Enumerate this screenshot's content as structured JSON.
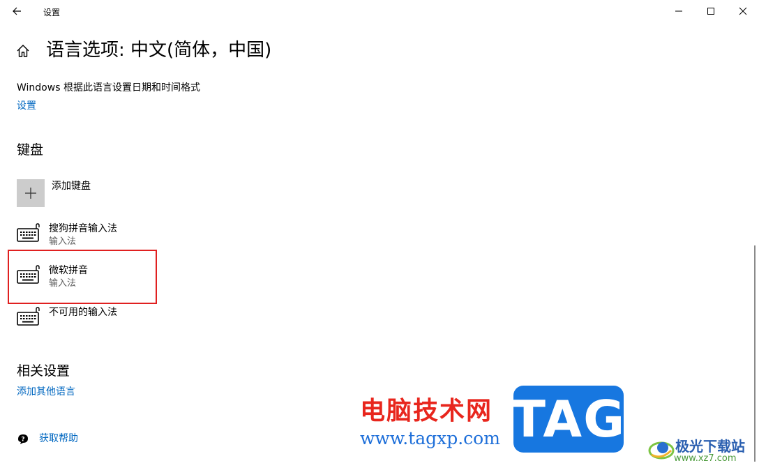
{
  "window": {
    "title": "设置",
    "back_icon": "arrow-left-icon",
    "controls": [
      "minimize-icon",
      "maximize-icon",
      "close-icon"
    ]
  },
  "header": {
    "home_icon": "home-icon",
    "title": "语言选项: 中文(简体，中国)"
  },
  "regional": {
    "description": "Windows 根据此语言设置日期和时间格式",
    "link": "设置"
  },
  "keyboard": {
    "heading": "键盘",
    "add_label": "添加键盘",
    "items": [
      {
        "title": "搜狗拼音输入法",
        "subtitle": "输入法",
        "icon": "keyboard-icon"
      },
      {
        "title": "微软拼音",
        "subtitle": "输入法",
        "icon": "keyboard-icon",
        "highlighted": true
      },
      {
        "title": "不可用的输入法",
        "subtitle": "",
        "icon": "keyboard-icon"
      }
    ]
  },
  "related": {
    "heading": "相关设置",
    "link": "添加其他语言"
  },
  "help": {
    "icon": "help-chat-icon",
    "link": "获取帮助"
  },
  "watermark": {
    "cn_text": "电脑技术网",
    "url": "www.tagxp.com",
    "tag": "TAG",
    "site_cn": "极光下载站",
    "site_url": "www.xz7.com"
  },
  "colors": {
    "accent": "#0067c0",
    "highlight_border": "#e02020",
    "add_tile": "#cccccc",
    "watermark_red": "#e8261d",
    "watermark_blue": "#1777e0"
  }
}
